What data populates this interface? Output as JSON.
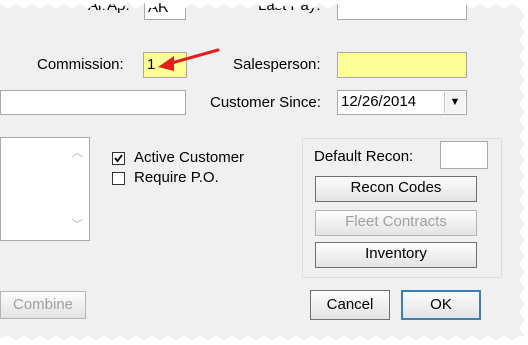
{
  "fields": {
    "ar_ap_label": "Ar/Ap:",
    "ar_ap_value": "AR",
    "last_pay_label": "Last Pay:",
    "last_pay_value": "",
    "commission_label": "Commission:",
    "commission_value": "1",
    "salesperson_label": "Salesperson:",
    "salesperson_value": "",
    "customer_since_label": "Customer Since:",
    "customer_since_value": "12/26/2014",
    "default_recon_label": "Default Recon:",
    "default_recon_value": ""
  },
  "checkboxes": {
    "active_customer_label": "Active Customer",
    "active_customer_checked": true,
    "require_po_label": "Require P.O.",
    "require_po_checked": false
  },
  "buttons": {
    "recon_codes": "Recon Codes",
    "fleet_contracts": "Fleet Contracts",
    "inventory": "Inventory",
    "combine": "Combine",
    "cancel": "Cancel",
    "ok": "OK"
  },
  "colors": {
    "highlight_field": "#ffff99",
    "annotation_arrow": "#e0201b"
  }
}
